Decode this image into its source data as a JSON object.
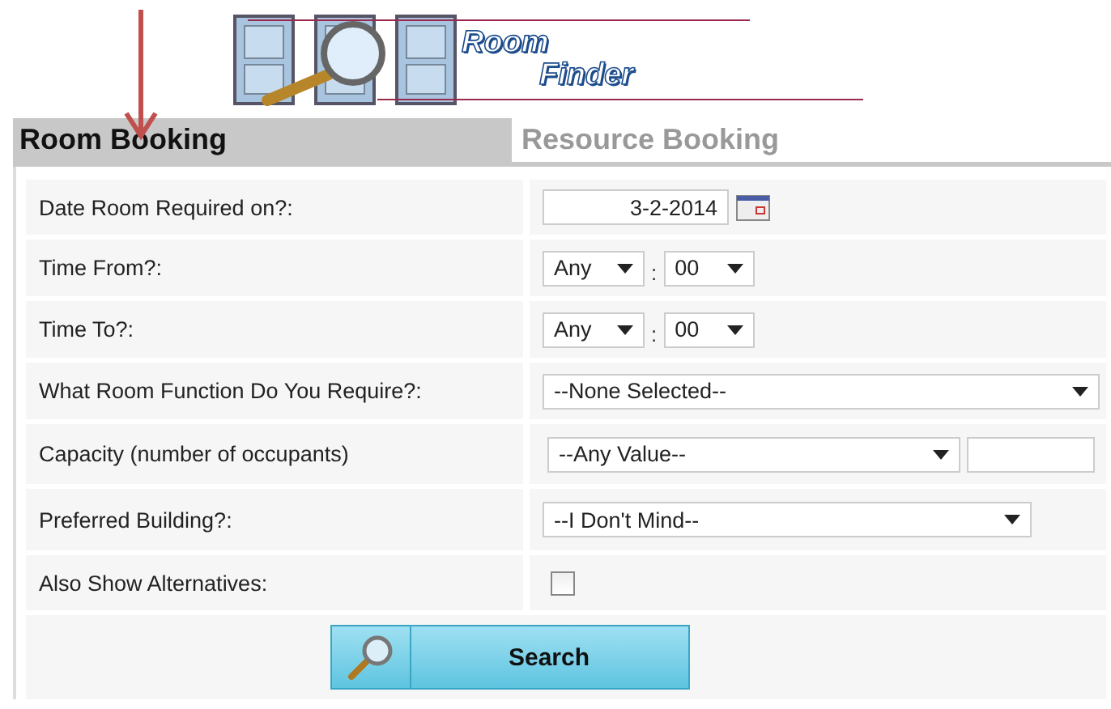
{
  "logo": {
    "line_1": "Room",
    "line_2": "Finder"
  },
  "tabs": [
    {
      "label": "Room Booking",
      "selected": true
    },
    {
      "label": "Resource Booking",
      "selected": false
    }
  ],
  "form": {
    "rows": [
      {
        "kind": "date",
        "label": "Date Room Required on?:",
        "value": "3-2-2014"
      },
      {
        "kind": "time",
        "label": "Time From?:",
        "hour": "Any",
        "separator": ":",
        "minute": "00"
      },
      {
        "kind": "time",
        "label": "Time To?:",
        "hour": "Any",
        "separator": ":",
        "minute": "00"
      },
      {
        "kind": "select_full",
        "label": "What Room Function Do You Require?:",
        "value": "--None Selected--"
      },
      {
        "kind": "select_input",
        "label": "Capacity (number of occupants)",
        "value": "--Any Value--"
      },
      {
        "kind": "select",
        "label": "Preferred Building?:",
        "value": "--I Don't Mind--"
      },
      {
        "kind": "checkbox",
        "label": "Also Show Alternatives:",
        "checked": false
      }
    ],
    "submit": {
      "label": "Search"
    }
  }
}
